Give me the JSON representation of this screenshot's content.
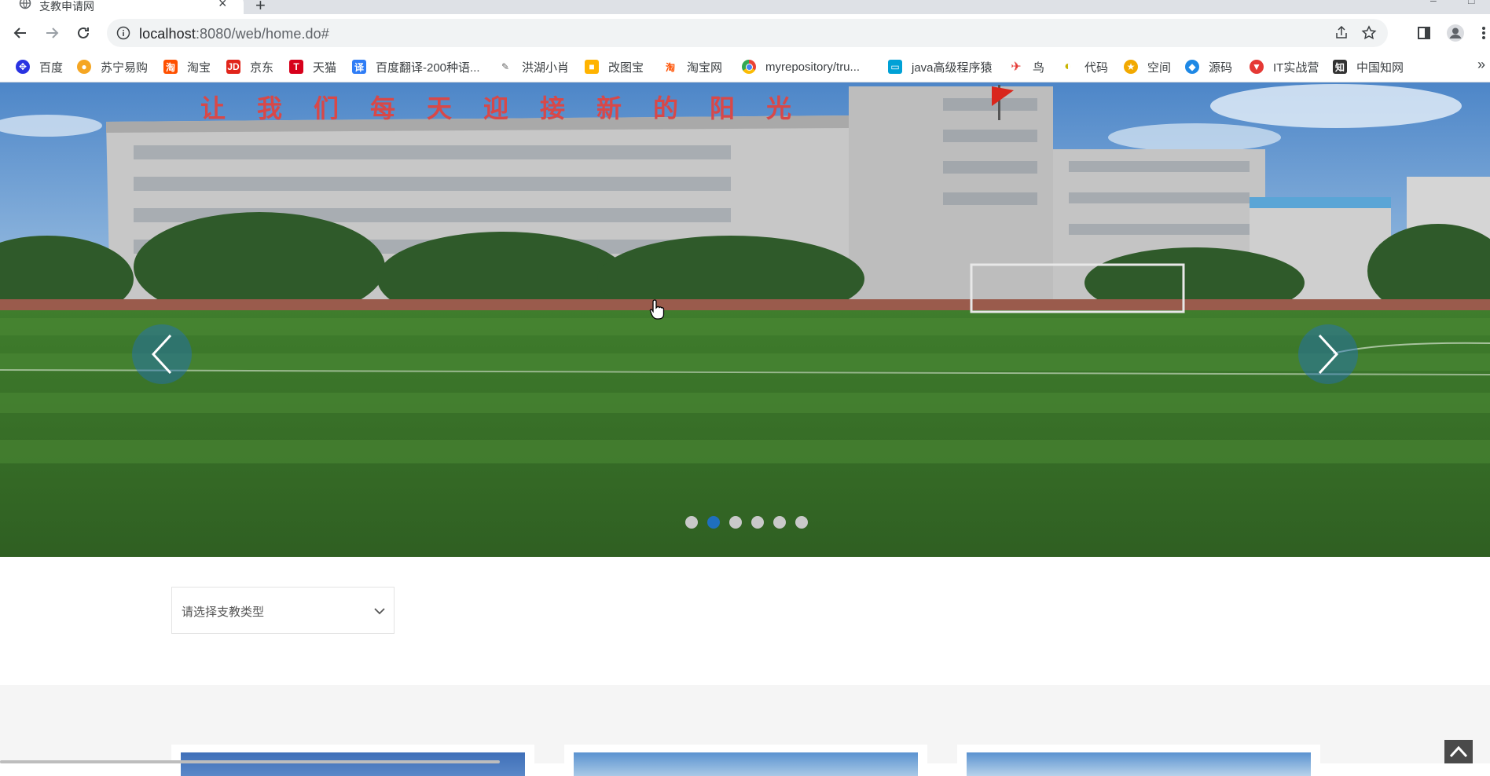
{
  "tab": {
    "title": "支教申请网",
    "close": "×",
    "new_tab": "+"
  },
  "window_controls": {
    "minimize": "–",
    "maximize": "□"
  },
  "address_bar": {
    "host": "localhost",
    "path": ":8080/web/home.do#"
  },
  "bookmarks": [
    {
      "label": "百度",
      "icon": "baidu-icon",
      "color": "#2932e1"
    },
    {
      "label": "苏宁易购",
      "icon": "suning-icon",
      "color": "#f5a623"
    },
    {
      "label": "淘宝",
      "icon": "taobao-icon",
      "color": "#ff5000"
    },
    {
      "label": "京东",
      "icon": "jd-icon",
      "color": "#e1251b"
    },
    {
      "label": "天猫",
      "icon": "tmall-icon",
      "color": "#d7001b"
    },
    {
      "label": "百度翻译-200种语...",
      "icon": "baidu-translate-icon",
      "color": "#2f7df6"
    },
    {
      "label": "洪湖小肖",
      "icon": "feather-icon",
      "color": "#666666"
    },
    {
      "label": "改图宝",
      "icon": "gaitubao-icon",
      "color": "#ffb300"
    },
    {
      "label": "淘宝网",
      "icon": "taobao-icon",
      "color": "#ff5000"
    },
    {
      "label": "myrepository/tru...",
      "icon": "chrome-icon",
      "color": "#4285f4"
    },
    {
      "label": "java高级程序猿",
      "icon": "bilibili-icon",
      "color": "#00a1d6"
    },
    {
      "label": "鸟",
      "icon": "bird-icon",
      "color": "#e53935"
    },
    {
      "label": "代码",
      "icon": "moon-icon",
      "color": "#c8b400"
    },
    {
      "label": "空间",
      "icon": "qzone-icon",
      "color": "#f2a900"
    },
    {
      "label": "源码",
      "icon": "fish-icon",
      "color": "#1e88e5"
    },
    {
      "label": "IT实战营",
      "icon": "it-icon",
      "color": "#e53935"
    },
    {
      "label": "中国知网",
      "icon": "cnki-icon",
      "color": "#333333"
    }
  ],
  "bookmarks_more": "»",
  "carousel": {
    "slogan": "让我们每天迎接新的阳光",
    "slide_count": 6,
    "active_index": 1
  },
  "filter": {
    "type_placeholder": "请选择支教类型"
  },
  "colors": {
    "accent": "#1f6fbe",
    "page_bg_gray": "#f5f5f5"
  }
}
